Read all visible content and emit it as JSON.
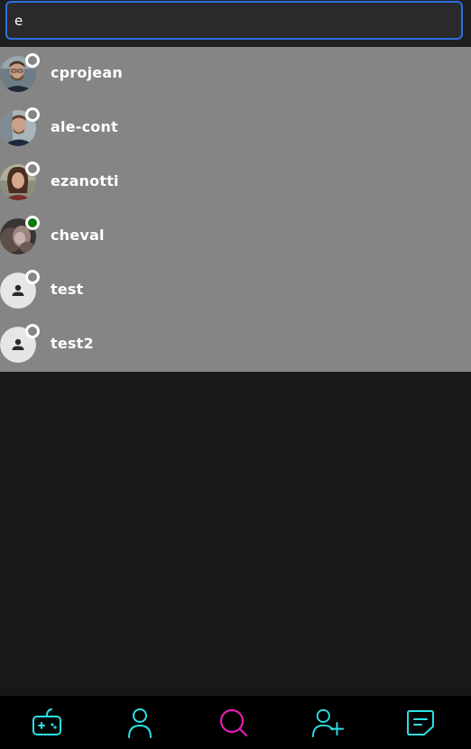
{
  "search": {
    "value": "e",
    "placeholder": ""
  },
  "results": [
    {
      "name": "cprojean",
      "status": "offline",
      "avatar": "photo"
    },
    {
      "name": "ale-cont",
      "status": "offline",
      "avatar": "photo"
    },
    {
      "name": "ezanotti",
      "status": "offline",
      "avatar": "photo"
    },
    {
      "name": "cheval",
      "status": "online",
      "avatar": "photo"
    },
    {
      "name": "test",
      "status": "offline",
      "avatar": "default-user-icon"
    },
    {
      "name": "test2",
      "status": "offline",
      "avatar": "default-user-icon"
    }
  ],
  "colors": {
    "accent": "#2ce0e6",
    "active": "#e020b0",
    "online": "#0a7a0a",
    "results_bg": "#858585",
    "page_bg": "#171818"
  },
  "nav": [
    {
      "icon": "game-controller-icon",
      "active": false
    },
    {
      "icon": "profile-icon",
      "active": false
    },
    {
      "icon": "search-icon",
      "active": true
    },
    {
      "icon": "add-friend-icon",
      "active": false
    },
    {
      "icon": "chat-icon",
      "active": false
    }
  ]
}
